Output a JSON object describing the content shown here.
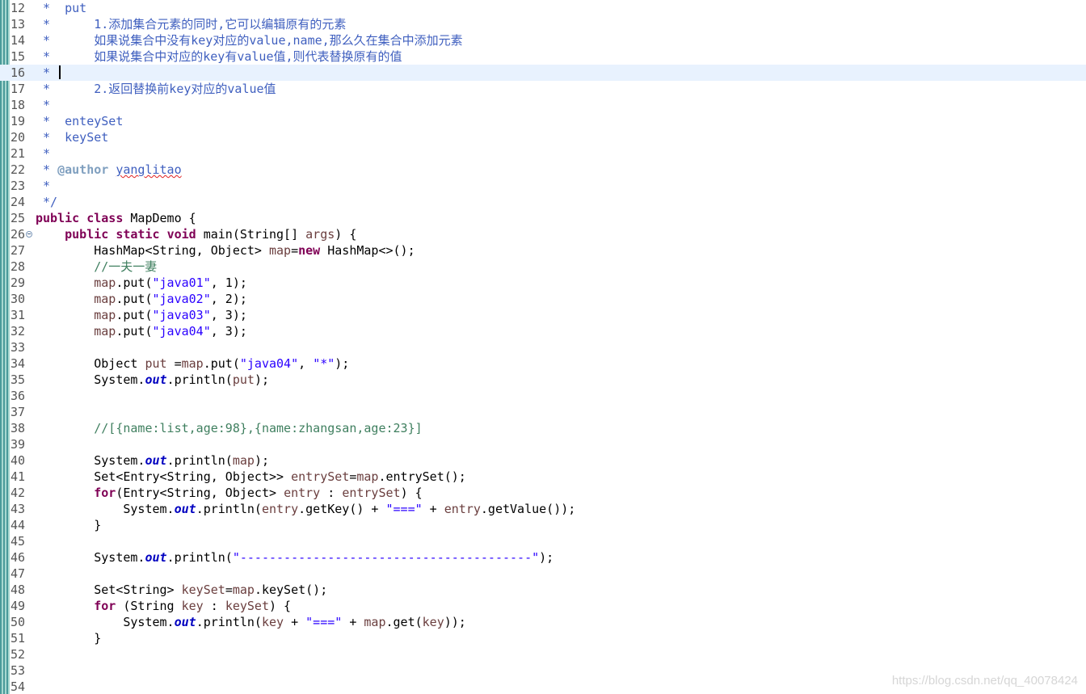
{
  "editor": {
    "lines": [
      {
        "n": "12",
        "segs": [
          [
            "doc",
            " *  put"
          ]
        ]
      },
      {
        "n": "13",
        "segs": [
          [
            "doc",
            " *      1.添加集合元素的同时,它可以编辑原有的元素"
          ]
        ]
      },
      {
        "n": "14",
        "segs": [
          [
            "doc",
            " *      如果说集合中没有key对应的value,name,那么久在集合中添加元素"
          ]
        ]
      },
      {
        "n": "15",
        "segs": [
          [
            "doc",
            " *      如果说集合中对应的key有value值,则代表替换原有的值"
          ]
        ]
      },
      {
        "n": "16",
        "segs": [
          [
            "doc",
            " * "
          ]
        ],
        "current": true
      },
      {
        "n": "17",
        "segs": [
          [
            "doc",
            " *      2.返回替换前key对应的value值"
          ]
        ]
      },
      {
        "n": "18",
        "segs": [
          [
            "doc",
            " *"
          ]
        ]
      },
      {
        "n": "19",
        "segs": [
          [
            "doc",
            " *  enteySet"
          ]
        ]
      },
      {
        "n": "20",
        "segs": [
          [
            "doc",
            " *  keySet"
          ]
        ]
      },
      {
        "n": "21",
        "segs": [
          [
            "doc",
            " *"
          ]
        ]
      },
      {
        "n": "22",
        "segs": [
          [
            "doc",
            " * "
          ],
          [
            "doctag",
            "@author"
          ],
          [
            "doc",
            " "
          ],
          [
            "doc squiggle",
            "yanglitao"
          ]
        ]
      },
      {
        "n": "23",
        "segs": [
          [
            "doc",
            " *"
          ]
        ]
      },
      {
        "n": "24",
        "segs": [
          [
            "doc",
            " */"
          ]
        ]
      },
      {
        "n": "25",
        "segs": [
          [
            "kw",
            "public"
          ],
          [
            "",
            " "
          ],
          [
            "kw",
            "class"
          ],
          [
            "",
            " MapDemo {"
          ]
        ]
      },
      {
        "n": "26",
        "fold": true,
        "segs": [
          [
            "",
            "    "
          ],
          [
            "kw",
            "public"
          ],
          [
            "",
            " "
          ],
          [
            "kw",
            "static"
          ],
          [
            "",
            " "
          ],
          [
            "kw",
            "void"
          ],
          [
            "",
            " main(String[] "
          ],
          [
            "var",
            "args"
          ],
          [
            "",
            ") {"
          ]
        ]
      },
      {
        "n": "27",
        "segs": [
          [
            "",
            "        HashMap<String, Object> "
          ],
          [
            "var",
            "map"
          ],
          [
            "",
            "="
          ],
          [
            "kw",
            "new"
          ],
          [
            "",
            " HashMap<>();"
          ]
        ]
      },
      {
        "n": "28",
        "segs": [
          [
            "cm",
            "        //一夫一妻"
          ]
        ]
      },
      {
        "n": "29",
        "segs": [
          [
            "",
            "        "
          ],
          [
            "var",
            "map"
          ],
          [
            "",
            ".put("
          ],
          [
            "str",
            "\"java01\""
          ],
          [
            "",
            ", 1);"
          ]
        ]
      },
      {
        "n": "30",
        "segs": [
          [
            "",
            "        "
          ],
          [
            "var",
            "map"
          ],
          [
            "",
            ".put("
          ],
          [
            "str",
            "\"java02\""
          ],
          [
            "",
            ", 2);"
          ]
        ]
      },
      {
        "n": "31",
        "segs": [
          [
            "",
            "        "
          ],
          [
            "var",
            "map"
          ],
          [
            "",
            ".put("
          ],
          [
            "str",
            "\"java03\""
          ],
          [
            "",
            ", 3);"
          ]
        ]
      },
      {
        "n": "32",
        "segs": [
          [
            "",
            "        "
          ],
          [
            "var",
            "map"
          ],
          [
            "",
            ".put("
          ],
          [
            "str",
            "\"java04\""
          ],
          [
            "",
            ", 3);"
          ]
        ]
      },
      {
        "n": "33",
        "segs": []
      },
      {
        "n": "34",
        "segs": [
          [
            "",
            "        Object "
          ],
          [
            "var",
            "put"
          ],
          [
            "",
            " ="
          ],
          [
            "var",
            "map"
          ],
          [
            "",
            ".put("
          ],
          [
            "str",
            "\"java04\""
          ],
          [
            "",
            ", "
          ],
          [
            "str",
            "\"*\""
          ],
          [
            "",
            ");"
          ]
        ]
      },
      {
        "n": "35",
        "segs": [
          [
            "",
            "        System."
          ],
          [
            "fld",
            "out"
          ],
          [
            "",
            ".println("
          ],
          [
            "var",
            "put"
          ],
          [
            "",
            ");"
          ]
        ]
      },
      {
        "n": "36",
        "segs": []
      },
      {
        "n": "37",
        "segs": []
      },
      {
        "n": "38",
        "segs": [
          [
            "cm",
            "        //[{name:list,age:98},{name:zhangsan,age:23}]"
          ]
        ]
      },
      {
        "n": "39",
        "segs": []
      },
      {
        "n": "40",
        "segs": [
          [
            "",
            "        System."
          ],
          [
            "fld",
            "out"
          ],
          [
            "",
            ".println("
          ],
          [
            "var",
            "map"
          ],
          [
            "",
            ");"
          ]
        ]
      },
      {
        "n": "41",
        "segs": [
          [
            "",
            "        Set<Entry<String, Object>> "
          ],
          [
            "var",
            "entrySet"
          ],
          [
            "",
            "="
          ],
          [
            "var",
            "map"
          ],
          [
            "",
            ".entrySet();"
          ]
        ]
      },
      {
        "n": "42",
        "segs": [
          [
            "",
            "        "
          ],
          [
            "kw",
            "for"
          ],
          [
            "",
            "(Entry<String, Object> "
          ],
          [
            "var",
            "entry"
          ],
          [
            "",
            " : "
          ],
          [
            "var",
            "entrySet"
          ],
          [
            "",
            ") {"
          ]
        ]
      },
      {
        "n": "43",
        "segs": [
          [
            "",
            "            System."
          ],
          [
            "fld",
            "out"
          ],
          [
            "",
            ".println("
          ],
          [
            "var",
            "entry"
          ],
          [
            "",
            ".getKey() + "
          ],
          [
            "str",
            "\"===\""
          ],
          [
            "",
            " + "
          ],
          [
            "var",
            "entry"
          ],
          [
            "",
            ".getValue());"
          ]
        ]
      },
      {
        "n": "44",
        "segs": [
          [
            "",
            "        }"
          ]
        ]
      },
      {
        "n": "45",
        "segs": []
      },
      {
        "n": "46",
        "segs": [
          [
            "",
            "        System."
          ],
          [
            "fld",
            "out"
          ],
          [
            "",
            ".println("
          ],
          [
            "str",
            "\"----------------------------------------\""
          ],
          [
            "",
            ");"
          ]
        ]
      },
      {
        "n": "47",
        "segs": []
      },
      {
        "n": "48",
        "segs": [
          [
            "",
            "        Set<String> "
          ],
          [
            "var",
            "keySet"
          ],
          [
            "",
            "="
          ],
          [
            "var",
            "map"
          ],
          [
            "",
            ".keySet();"
          ]
        ]
      },
      {
        "n": "49",
        "segs": [
          [
            "",
            "        "
          ],
          [
            "kw",
            "for"
          ],
          [
            "",
            " (String "
          ],
          [
            "var",
            "key"
          ],
          [
            "",
            " : "
          ],
          [
            "var",
            "keySet"
          ],
          [
            "",
            ") {"
          ]
        ]
      },
      {
        "n": "50",
        "segs": [
          [
            "",
            "            System."
          ],
          [
            "fld",
            "out"
          ],
          [
            "",
            ".println("
          ],
          [
            "var",
            "key"
          ],
          [
            "",
            " + "
          ],
          [
            "str",
            "\"===\""
          ],
          [
            "",
            " + "
          ],
          [
            "var",
            "map"
          ],
          [
            "",
            ".get("
          ],
          [
            "var",
            "key"
          ],
          [
            "",
            "));"
          ]
        ]
      },
      {
        "n": "51",
        "segs": [
          [
            "",
            "        }"
          ]
        ]
      },
      {
        "n": "52",
        "segs": []
      },
      {
        "n": "53",
        "segs": []
      },
      {
        "n": "54",
        "segs": []
      }
    ]
  },
  "watermark": "https://blog.csdn.net/qq_40078424",
  "colors": {
    "keyword": "#7f0055",
    "string": "#2a00ff",
    "comment": "#3f7f5f",
    "javadoc": "#3f5fbf",
    "variable": "#6a3e3e",
    "static_field": "#0000c0",
    "current_line": "#e8f2fe"
  }
}
